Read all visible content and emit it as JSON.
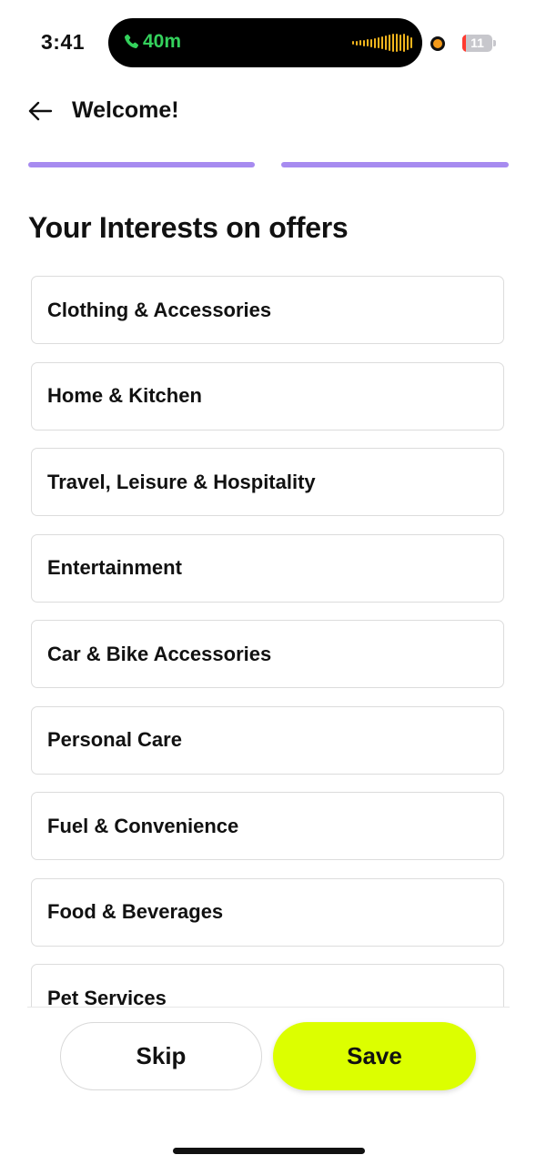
{
  "status_bar": {
    "time": "3:41",
    "call_duration": "40m",
    "battery_level": "11",
    "battery_fraction": 0.11,
    "icons": [
      "phone-icon",
      "waveform-icon",
      "recording-dot-icon",
      "battery-icon"
    ],
    "colors": {
      "call": "#34d15c",
      "waveform": "#f4b51d",
      "recording": "#f49a1a",
      "battery_low": "#ff3b30"
    }
  },
  "header": {
    "back_icon": "arrow-left-icon",
    "title": "Welcome!"
  },
  "progress": {
    "steps_total": 2,
    "steps_completed": 2,
    "color": "#a78bf0"
  },
  "section": {
    "title": "Your Interests on offers"
  },
  "interests": [
    {
      "label": "Clothing & Accessories"
    },
    {
      "label": "Home & Kitchen"
    },
    {
      "label": "Travel, Leisure & Hospitality"
    },
    {
      "label": "Entertainment"
    },
    {
      "label": "Car & Bike Accessories"
    },
    {
      "label": "Personal Care"
    },
    {
      "label": "Fuel & Convenience"
    },
    {
      "label": "Food & Beverages"
    },
    {
      "label": "Pet Services"
    }
  ],
  "actions": {
    "skip_label": "Skip",
    "save_label": "Save",
    "save_color": "#dcff00"
  }
}
